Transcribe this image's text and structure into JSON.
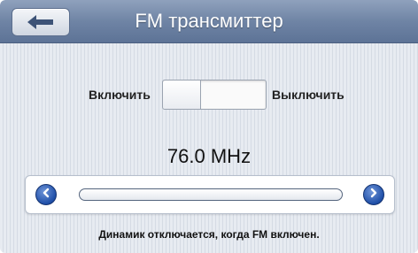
{
  "header": {
    "title": "FM трансмиттер",
    "back_icon": "back-arrow-icon"
  },
  "toggle": {
    "on_label": "Включить",
    "off_label": "Выключить"
  },
  "frequency": {
    "value": "76.0 MHz"
  },
  "slider": {
    "left_icon": "chevron-left-icon",
    "right_icon": "chevron-right-icon",
    "position": 0.0
  },
  "note": {
    "text": "Динамик отключается, когда FM включен."
  },
  "colors": {
    "header": "#6f84a5",
    "accent": "#1f4fa8"
  }
}
